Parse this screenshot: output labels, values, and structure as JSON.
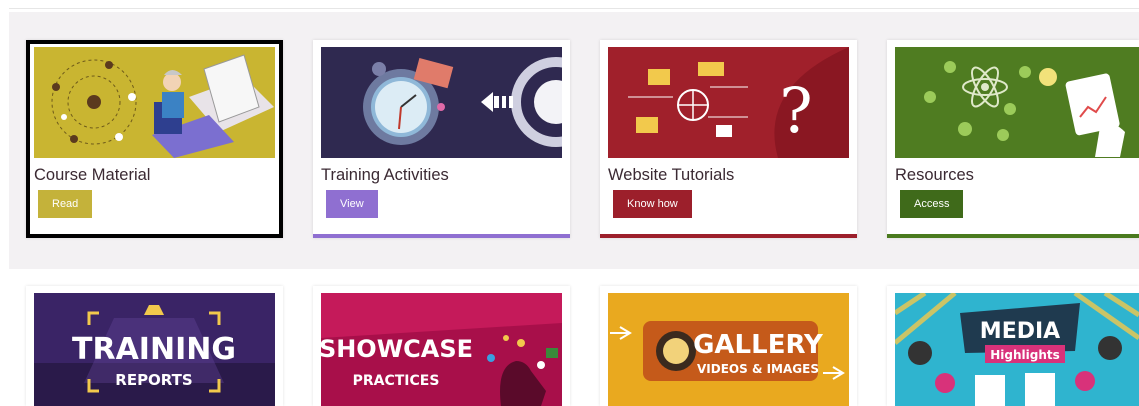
{
  "cards": [
    {
      "title": "Course Material",
      "button": "Read",
      "color": "#c4b23a",
      "image": "person-laptop-illustration"
    },
    {
      "title": "Training Activities",
      "button": "View",
      "color": "#8f6fd1",
      "bar": "#8f6fd1",
      "image": "clock-gears-illustration"
    },
    {
      "title": "Website Tutorials",
      "button": "Know how",
      "color": "#9c1f2b",
      "bar": "#9c1f2b",
      "image": "question-mark-illustration"
    },
    {
      "title": "Resources",
      "button": "Access",
      "color": "#3f6a1a",
      "bar": "#4a7a1e",
      "image": "touch-screen-illustration"
    }
  ],
  "tiles": [
    {
      "line1": "TRAINING",
      "line2": "REPORTS"
    },
    {
      "line1": "SHOWCASE",
      "line2": "PRACTICES"
    },
    {
      "line1": "GALLERY",
      "line2": "VIDEOS & IMAGES"
    },
    {
      "line1": "MEDIA",
      "line2": "Highlights"
    }
  ]
}
